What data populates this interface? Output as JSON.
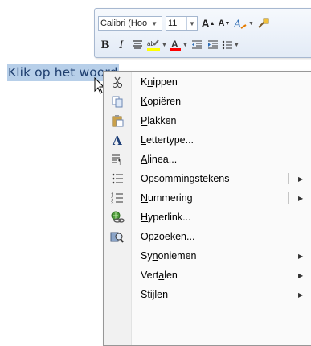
{
  "document": {
    "selected_text": "Klik op het woord"
  },
  "mini_toolbar": {
    "font_name": "Calibri (Hoo",
    "font_size": "11",
    "grow_font": "A",
    "shrink_font": "A",
    "bold": "B",
    "italic": "I"
  },
  "context_menu": {
    "items": [
      {
        "label": "Knippen",
        "accel": "n",
        "pre": "K",
        "post": "ippen",
        "icon": "scissors-icon"
      },
      {
        "label": "Kopiëren",
        "accel": "K",
        "pre": "",
        "post": "opiëren",
        "icon": "copy-icon"
      },
      {
        "label": "Plakken",
        "accel": "P",
        "pre": "",
        "post": "lakken",
        "icon": "paste-icon"
      },
      {
        "label": "Lettertype...",
        "accel": "L",
        "pre": "",
        "post": "ettertype...",
        "icon": "font-icon"
      },
      {
        "label": "Alinea...",
        "accel": "A",
        "pre": "",
        "post": "linea...",
        "icon": "paragraph-icon"
      },
      {
        "label": "Opsommingstekens",
        "accel": "O",
        "pre": "",
        "post": "psommingstekens",
        "icon": "bullets-icon"
      },
      {
        "label": "Nummering",
        "accel": "N",
        "pre": "",
        "post": "ummering",
        "icon": "numbering-icon"
      },
      {
        "label": "Hyperlink...",
        "accel": "H",
        "pre": "",
        "post": "yperlink...",
        "icon": "hyperlink-icon"
      },
      {
        "label": "Opzoeken...",
        "accel": "O",
        "pre": "",
        "post": "pzoeken...",
        "icon": "research-icon"
      },
      {
        "label": "Synoniemen",
        "accel": "n",
        "pre": "Sy",
        "post": "oniemen",
        "icon": ""
      },
      {
        "label": "Vertalen",
        "accel": "a",
        "pre": "Vert",
        "post": "len",
        "icon": ""
      },
      {
        "label": "Stijlen",
        "accel": "t",
        "pre": "S",
        "post": "ijlen",
        "icon": ""
      }
    ]
  },
  "colors": {
    "selection": "#b7cfe9",
    "highlight": "#ffff00",
    "font_color": "#ff0000"
  }
}
